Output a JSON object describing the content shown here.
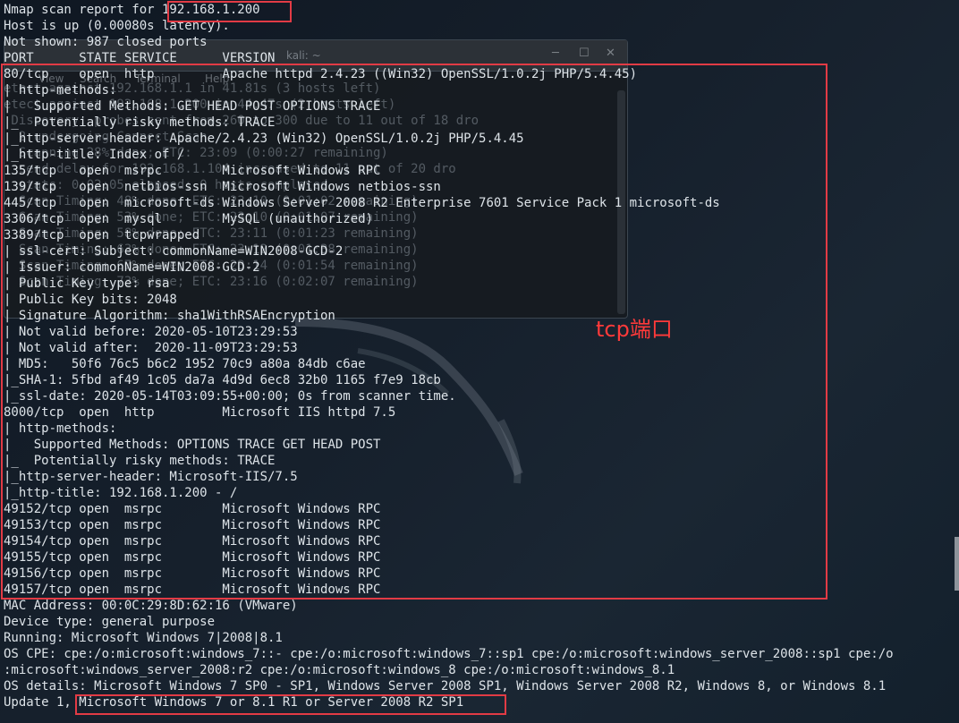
{
  "background_terminal": {
    "title": "kali: ~",
    "menu": [
      "View",
      "Search",
      "Terminal",
      "Help"
    ],
    "lines": [
      "",
      "",
      "",
      "",
      "",
      "etect against 192.168.1.1 in 41.81s (3 hosts left)",
      "etect against 192.168.1.200 in 44.47s (2 hosts left)",
      " Discovery: probes sent from 260 to 300 due to 11 out of 18 dro",
      "  2 undergoing Connect Scan",
      "  Scanning 28% done; ETC: 23:09 (0:00:27 remaining)",
      "  send delay for 192.168.1.104 increased to 11 out of 20 dro",
      "  stats: 0:02:05 elapsed; 0 hosts completed",
      "  Scan Timing: 48% done; ETC: 23:10 (0:01:02 remaining)",
      "  Scan Timing: 53% done; ETC: 23:10 (0:01:07 remaining)",
      "  Scan Timing: 58% done; ETC: 23:11 (0:01:23 remaining)",
      "  Scan Timing: 63% done; ETC: 23:12 (0:01:38 remaining)",
      "  Scan Timing: 67% done; ETC: 23:14 (0:01:54 remaining)",
      "  Scan Timing: 73% done; ETC: 23:16 (0:02:07 remaining)"
    ]
  },
  "terminal": {
    "lines": [
      "Nmap scan report for 192.168.1.200",
      "Host is up (0.00080s latency).",
      "Not shown: 987 closed ports",
      "PORT      STATE SERVICE      VERSION",
      "80/tcp    open  http         Apache httpd 2.4.23 ((Win32) OpenSSL/1.0.2j PHP/5.4.45)",
      "| http-methods: ",
      "|   Supported Methods: GET HEAD POST OPTIONS TRACE",
      "|_  Potentially risky methods: TRACE",
      "|_http-server-header: Apache/2.4.23 (Win32) OpenSSL/1.0.2j PHP/5.4.45",
      "|_http-title: Index of /",
      "135/tcp   open  msrpc        Microsoft Windows RPC",
      "139/tcp   open  netbios-ssn  Microsoft Windows netbios-ssn",
      "445/tcp   open  microsoft-ds Windows Server 2008 R2 Enterprise 7601 Service Pack 1 microsoft-ds",
      "3306/tcp  open  mysql        MySQL (unauthorized)",
      "3389/tcp  open  tcpwrapped",
      "| ssl-cert: Subject: commonName=WIN2008-GCD-2",
      "| Issuer: commonName=WIN2008-GCD-2",
      "| Public Key type: rsa",
      "| Public Key bits: 2048",
      "| Signature Algorithm: sha1WithRSAEncryption",
      "| Not valid before: 2020-05-10T23:29:53",
      "| Not valid after:  2020-11-09T23:29:53",
      "| MD5:   50f6 76c5 b6c2 1952 70c9 a80a 84db c6ae",
      "|_SHA-1: 5fbd af49 1c05 da7a 4d9d 6ec8 32b0 1165 f7e9 18cb",
      "|_ssl-date: 2020-05-14T03:09:55+00:00; 0s from scanner time.",
      "8000/tcp  open  http         Microsoft IIS httpd 7.5",
      "| http-methods: ",
      "|   Supported Methods: OPTIONS TRACE GET HEAD POST",
      "|_  Potentially risky methods: TRACE",
      "|_http-server-header: Microsoft-IIS/7.5",
      "|_http-title: 192.168.1.200 - /",
      "49152/tcp open  msrpc        Microsoft Windows RPC",
      "49153/tcp open  msrpc        Microsoft Windows RPC",
      "49154/tcp open  msrpc        Microsoft Windows RPC",
      "49155/tcp open  msrpc        Microsoft Windows RPC",
      "49156/tcp open  msrpc        Microsoft Windows RPC",
      "49157/tcp open  msrpc        Microsoft Windows RPC",
      "MAC Address: 00:0C:29:8D:62:16 (VMware)",
      "Device type: general purpose",
      "Running: Microsoft Windows 7|2008|8.1",
      "OS CPE: cpe:/o:microsoft:windows_7::- cpe:/o:microsoft:windows_7::sp1 cpe:/o:microsoft:windows_server_2008::sp1 cpe:/o",
      ":microsoft:windows_server_2008:r2 cpe:/o:microsoft:windows_8 cpe:/o:microsoft:windows_8.1",
      "OS details: Microsoft Windows 7 SP0 - SP1, Windows Server 2008 SP1, Windows Server 2008 R2, Windows 8, or Windows 8.1",
      "Update 1, Microsoft Windows 7 or 8.1 R1 or Server 2008 R2 SP1"
    ]
  },
  "annotation": {
    "label": "tcp端口",
    "color": "#ff3a3a"
  },
  "colors": {
    "highlight_border": "#e23b45",
    "terminal_text": "#dde3e8",
    "background": "#16202c"
  }
}
